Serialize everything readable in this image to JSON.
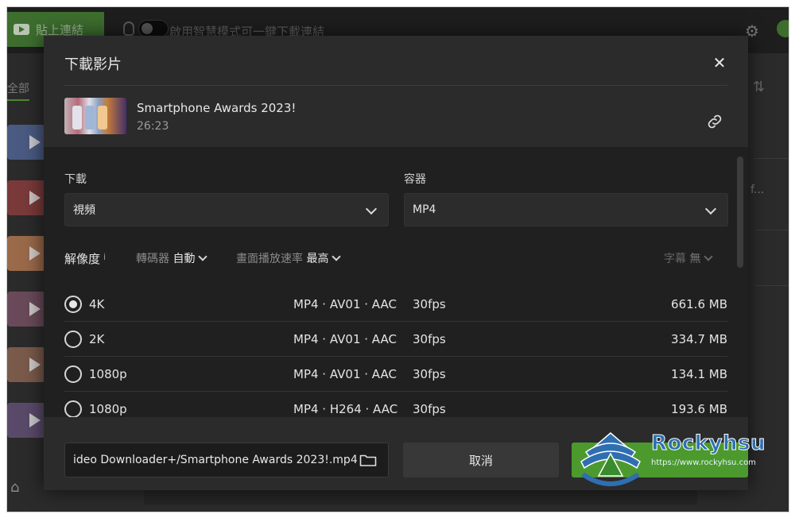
{
  "background_app": {
    "paste_label": "貼上連結",
    "smart_mode_text": "啟用智慧模式可一鍵下載連結",
    "tab_all": "全部",
    "ellipsis": "f..."
  },
  "dialog": {
    "title": "下載影片",
    "close_glyph": "✕",
    "video": {
      "title": "Smartphone Awards 2023!",
      "duration": "26:23"
    },
    "download_label": "下載",
    "download_value": "視頻",
    "container_label": "容器",
    "container_value": "MP4",
    "options": {
      "resolution_label": "解像度",
      "info_glyph": "i",
      "codec_label": "轉碼器",
      "codec_value": "自動",
      "framerate_label": "畫面播放速率",
      "framerate_value": "最高",
      "subtitle_label": "字幕",
      "subtitle_value": "無"
    },
    "rows": [
      {
        "label": "4K",
        "format": "MP4 · AV01 · AAC",
        "fps": "30fps",
        "size": "661.6 MB",
        "selected": true
      },
      {
        "label": "2K",
        "format": "MP4 · AV01 · AAC",
        "fps": "30fps",
        "size": "334.7 MB",
        "selected": false
      },
      {
        "label": "1080p",
        "format": "MP4 · AV01 · AAC",
        "fps": "30fps",
        "size": "134.1 MB",
        "selected": false
      },
      {
        "label": "1080p",
        "format": "MP4 · H264 · AAC",
        "fps": "30fps",
        "size": "193.6 MB",
        "selected": false
      }
    ],
    "save_path": "ideo Downloader+/Smartphone Awards 2023!.mp4",
    "cancel_label": "取消"
  },
  "watermark": {
    "name": "Rockyhsu",
    "url": "https://www.rockyhsu.com"
  },
  "colors": {
    "accent_green": "#4c9a2e",
    "panel": "#2b2b2b",
    "panel_dark": "#202020"
  }
}
